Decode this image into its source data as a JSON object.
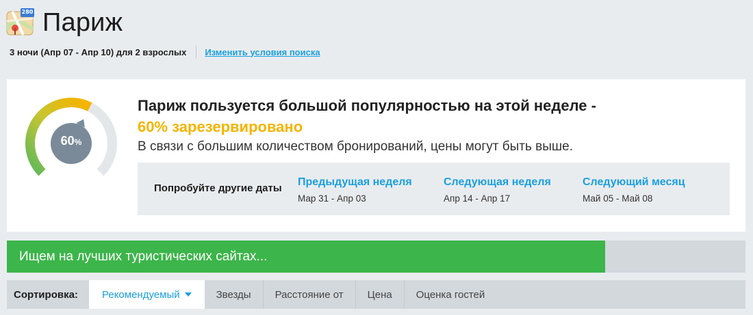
{
  "header": {
    "title": "Париж",
    "icon": "map-icon",
    "map_badge": "280"
  },
  "subline": {
    "trip": "3 ночи (Апр 07 - Апр 10) для 2 взрослых",
    "change_link": "Изменить условия поиска"
  },
  "popularity": {
    "headline": "Париж пользуется большой популярностью на этой неделе -",
    "percent_text": "60% зарезервировано",
    "gauge_value": "60",
    "gauge_unit": "%",
    "gauge_fraction": 0.6,
    "description": "В связи с большим количеством бронирований, цены могут быть выше.",
    "colors": {
      "gauge_low": "#5cb85c",
      "gauge_high": "#f5b400",
      "gauge_track": "#e4e7ea",
      "knob": "#7a8a99"
    }
  },
  "dates": {
    "label": "Попробуйте другие даты",
    "options": [
      {
        "name": "Предыдущая неделя",
        "range": "Мар 31 - Апр 03"
      },
      {
        "name": "Следующая неделя",
        "range": "Апр 14 - Апр 17"
      },
      {
        "name": "Следующий месяц",
        "range": "Май 05 - Май 08"
      }
    ]
  },
  "progress": {
    "label": "Ищем на лучших туристических сайтах...",
    "value": 0.81,
    "color": "#3cb54a"
  },
  "sort": {
    "label": "Сортировка:",
    "options": [
      "Рекомендуемый",
      "Звезды",
      "Расстояние от",
      "Цена",
      "Оценка гостей"
    ],
    "selected": "Рекомендуемый"
  },
  "colors": {
    "accent": "#1a9fe0",
    "warning": "#f5b400",
    "success": "#3cb54a"
  }
}
